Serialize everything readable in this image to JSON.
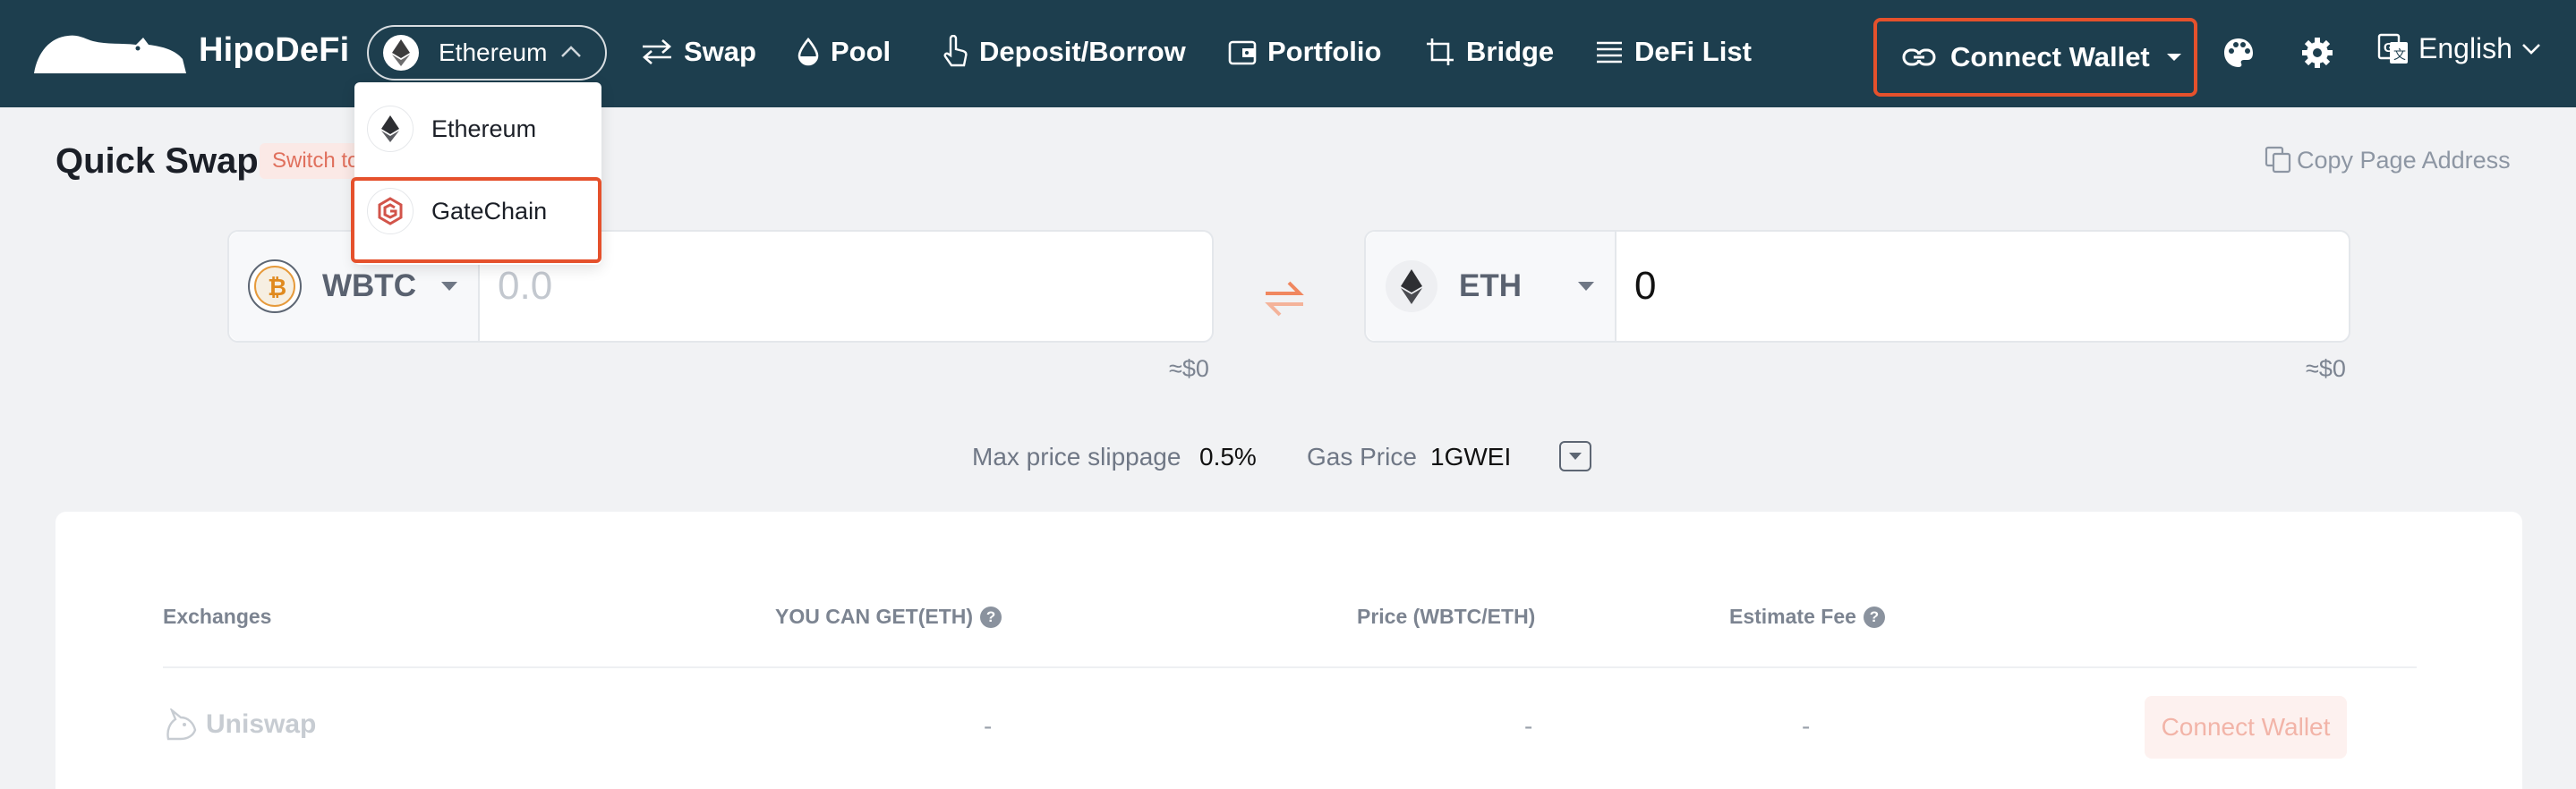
{
  "brand": {
    "name": "HipoDeFi"
  },
  "chain_selector": {
    "selected": "Ethereum"
  },
  "nav": {
    "swap": "Swap",
    "pool": "Pool",
    "deposit_borrow": "Deposit/Borrow",
    "portfolio": "Portfolio",
    "bridge": "Bridge",
    "defi_list": "DeFi List"
  },
  "header": {
    "connect_wallet": "Connect Wallet",
    "language": "English"
  },
  "chain_dropdown": {
    "items": [
      {
        "label": "Ethereum"
      },
      {
        "label": "GateChain"
      }
    ]
  },
  "page": {
    "title": "Quick Swap",
    "switch_tag": "Switch to",
    "copy_address": "Copy Page Address"
  },
  "swap": {
    "from": {
      "token": "WBTC",
      "placeholder": "0.0",
      "usd": "≈$0"
    },
    "to": {
      "token": "ETH",
      "amount": "0",
      "usd": "≈$0"
    }
  },
  "settings": {
    "slippage_label": "Max price slippage",
    "slippage_value": "0.5%",
    "gas_label": "Gas Price",
    "gas_value": "1GWEI"
  },
  "table": {
    "headers": {
      "exchanges": "Exchanges",
      "you_can_get": "YOU CAN GET(ETH)",
      "price": "Price (WBTC/ETH)",
      "fee": "Estimate Fee"
    },
    "rows": [
      {
        "exchange": "Uniswap",
        "get": "-",
        "price": "-",
        "fee": "-",
        "action": "Connect Wallet"
      }
    ]
  },
  "colors": {
    "nav_bg": "#1d3e4e",
    "highlight": "#e5512c",
    "swap_arrow": "#f0875f",
    "page_bg": "#f1f2f4"
  },
  "icons": [
    "hippo-logo-icon",
    "ethereum-icon",
    "chevron-up-icon",
    "swap-arrows-icon",
    "droplet-icon",
    "hand-pointer-icon",
    "wallet-icon",
    "crop-icon",
    "list-icon",
    "link-icon",
    "caret-down-icon",
    "palette-icon",
    "gear-icon",
    "translate-icon",
    "chevron-down-icon",
    "copy-icon",
    "bitcoin-icon",
    "gatechain-icon",
    "question-icon",
    "unicorn-icon"
  ]
}
